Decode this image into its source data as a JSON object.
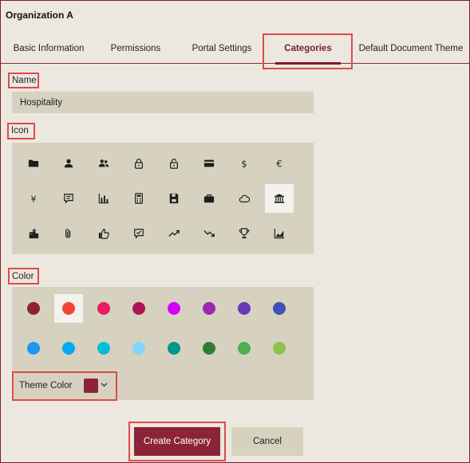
{
  "org": {
    "title": "Organization A"
  },
  "tabs": [
    {
      "label": "Basic Information"
    },
    {
      "label": "Permissions"
    },
    {
      "label": "Portal Settings"
    },
    {
      "label": "Categories",
      "active": true
    },
    {
      "label": "Default Document Theme"
    }
  ],
  "form": {
    "name_label": "Name",
    "name_value": "Hospitality",
    "icon_label": "Icon",
    "color_label": "Color",
    "theme_color_label": "Theme Color",
    "theme_color": "#8b2436"
  },
  "icons": [
    "folder-icon",
    "person-icon",
    "people-icon",
    "lock-icon",
    "unlock-icon",
    "credit-card-icon",
    "dollar-icon",
    "euro-icon",
    "yen-icon",
    "comment-icon",
    "bar-chart-icon",
    "calculator-icon",
    "save-icon",
    "briefcase-icon",
    "cloud-icon",
    "bank-icon",
    "city-icon",
    "attachment-icon",
    "thumbs-up-icon",
    "feedback-icon",
    "trend-up-icon",
    "trend-down-icon",
    "trophy-icon",
    "area-chart-icon"
  ],
  "selected_icon": "bank-icon",
  "colors": [
    "#8b2436",
    "#f44336",
    "#e91e63",
    "#ad1457",
    "#d500f9",
    "#9c27b0",
    "#673ab7",
    "#3f51b5",
    "#2196f3",
    "#03a9f4",
    "#00bcd4",
    "#81d4fa",
    "#009688",
    "#2e7d32",
    "#4caf50",
    "#8bc34a"
  ],
  "selected_color": "#f44336",
  "buttons": {
    "create": "Create Category",
    "cancel": "Cancel"
  }
}
